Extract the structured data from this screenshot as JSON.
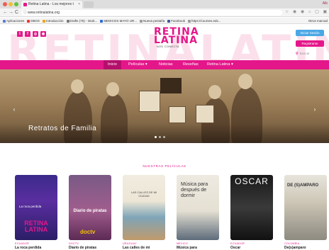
{
  "browser": {
    "tab_title": "Retina Latina - Los mejores t",
    "tab_close": "×",
    "user_label": "Alb",
    "back": "←",
    "forward": "→",
    "reload": "C",
    "url": "www.retinalatina.org",
    "toolbar_icons": "☆ ◉ ◉ ⌂ ▢ ▣ ⋮"
  },
  "bookmarks": [
    {
      "label": "Aplicaciones",
      "color": "#5a7bd6"
    },
    {
      "label": "DBOX",
      "color": "#e33"
    },
    {
      "label": "Introducción",
      "color": "#f2a300"
    },
    {
      "label": "Drafts (76) - intob...",
      "color": "#7a7a7a"
    },
    {
      "label": "MEDICOS MAYO UR...",
      "color": "#2a6cd6"
    },
    {
      "label": "Nueva pestaña",
      "color": "#9b9b9b"
    },
    {
      "label": "Facebook",
      "color": "#3b5998"
    },
    {
      "label": "https://courses.edx...",
      "color": "#999"
    }
  ],
  "bookmarks_other": "Otros marcad",
  "site": {
    "watermark": "RETINALATIN",
    "social": [
      "t",
      "f",
      "◎",
      "◉"
    ],
    "logo_line1": "RETINA",
    "logo_line2": "LATINA",
    "logo_tagline": "NOS CONECTA",
    "login_button": "Iniciar Sesión",
    "register_button": "Registrarse",
    "search_icon": "⚲",
    "search_label": "Buscar"
  },
  "nav": [
    {
      "label": "Inicio",
      "active": true
    },
    {
      "label": "Películas ▾",
      "active": false
    },
    {
      "label": "Noticias",
      "active": false
    },
    {
      "label": "Reseñas",
      "active": false
    },
    {
      "label": "Retina Latina ▾",
      "active": false
    }
  ],
  "hero": {
    "title": "Retratos de Familia",
    "prev": "‹",
    "next": "›"
  },
  "section_title": "NUESTRAS PELÍCULAS",
  "movies": [
    {
      "country": "ECUADOR",
      "title": "La roca perdida",
      "poster_text": "La roca perdida",
      "poster_logo": "RETINA LATINA"
    },
    {
      "country": "DOCTV",
      "title": "Diario de piratas",
      "poster_text": "Diario de piratas",
      "poster_logo": "doctv"
    },
    {
      "country": "URUGUAY",
      "title": "Las calles de mi",
      "poster_text": "LAS CALLES DE MI CIUDAD",
      "poster_logo": ""
    },
    {
      "country": "MÉXICO",
      "title": "Música para",
      "poster_text": "Música para después de dormir",
      "poster_logo": ""
    },
    {
      "country": "ECUADOR",
      "title": "Oscar",
      "poster_text": "OSCAR",
      "poster_logo": ""
    },
    {
      "country": "COLOMBIA",
      "title": "De(s)amparo",
      "poster_text": "DE (S)AMPARO",
      "poster_logo": ""
    }
  ]
}
